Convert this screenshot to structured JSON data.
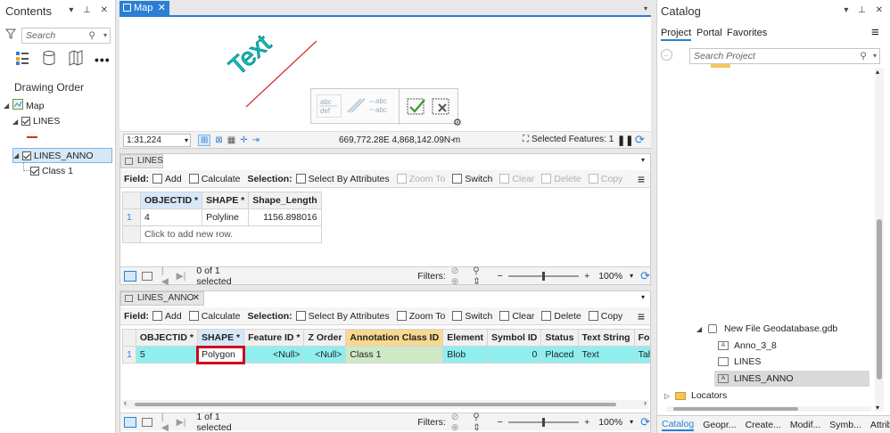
{
  "contents": {
    "title": "Contents",
    "search_placeholder": "Search",
    "section_title": "Drawing Order",
    "layers": [
      {
        "label": "Map"
      },
      {
        "label": "LINES"
      },
      {
        "label": "LINES_ANNO"
      },
      {
        "label": "Class 1"
      }
    ]
  },
  "map_view": {
    "tab_label": "Map",
    "annotation_text": "Text",
    "scale": "1:31,224",
    "coordinates": "669,772.28E 4,868,142.09N m",
    "selected_features": "Selected Features: 1"
  },
  "table1": {
    "tab_label": "LINES",
    "toolbar": {
      "field_label": "Field:",
      "add": "Add",
      "calculate": "Calculate",
      "selection_label": "Selection:",
      "select_by_attributes": "Select By Attributes",
      "zoom_to": "Zoom To",
      "switch": "Switch",
      "clear": "Clear",
      "delete": "Delete",
      "copy": "Copy"
    },
    "columns": [
      "OBJECTID *",
      "SHAPE *",
      "Shape_Length"
    ],
    "rows": [
      {
        "index": "1",
        "objectid": "4",
        "shape": "Polyline",
        "length": "1156.898016"
      }
    ],
    "add_row_hint": "Click to add new row.",
    "selected_text": "0 of 1 selected",
    "filters_label": "Filters:",
    "zoom": "100%"
  },
  "table2": {
    "tab_label": "LINES_ANNO",
    "toolbar": {
      "field_label": "Field:",
      "add": "Add",
      "calculate": "Calculate",
      "selection_label": "Selection:",
      "select_by_attributes": "Select By Attributes",
      "zoom_to": "Zoom To",
      "switch": "Switch",
      "clear": "Clear",
      "delete": "Delete",
      "copy": "Copy"
    },
    "columns": [
      "OBJECTID *",
      "SHAPE *",
      "Feature ID *",
      "Z Order",
      "Annotation Class ID",
      "Element",
      "Symbol ID",
      "Status",
      "Text String",
      "Font"
    ],
    "row": {
      "index": "1",
      "objectid": "5",
      "shape": "Polygon",
      "feature_id": "<Null>",
      "z_order": "<Null>",
      "class_id": "Class 1",
      "element": "Blob",
      "symbol_id": "0",
      "status": "Placed",
      "text_string": "Text",
      "font": "Taho"
    },
    "selected_text": "1 of 1 selected",
    "filters_label": "Filters:",
    "zoom": "100%"
  },
  "catalog": {
    "title": "Catalog",
    "tabs": [
      "Project",
      "Portal",
      "Favorites"
    ],
    "search_placeholder": "Search Project",
    "tree": {
      "gdb": "New File Geodatabase.gdb",
      "items": [
        "Anno_3_8",
        "LINES",
        "LINES_ANNO"
      ],
      "locators": "Locators"
    },
    "bottom_tabs": [
      "Catalog",
      "Geopr...",
      "Create...",
      "Modif...",
      "Symb...",
      "Attrib..."
    ]
  },
  "colors": {
    "accent": "#2a7fd4",
    "selected_row": "#8fefef",
    "annotation_cyan": "#16c9c9",
    "line_red": "#d0312d",
    "highlight_box": "#d0021b"
  }
}
